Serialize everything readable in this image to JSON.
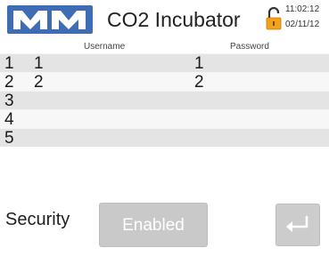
{
  "header": {
    "logo_text": "MM",
    "title": "CO2 Incubator",
    "time": "11:02:12",
    "date": "02/11/12"
  },
  "columns": {
    "username": "Username",
    "password": "Password"
  },
  "rows": [
    {
      "number": "1",
      "username": "1",
      "password": "1"
    },
    {
      "number": "2",
      "username": "2",
      "password": "2"
    },
    {
      "number": "3",
      "username": "",
      "password": ""
    },
    {
      "number": "4",
      "username": "",
      "password": ""
    },
    {
      "number": "5",
      "username": "",
      "password": ""
    }
  ],
  "security": {
    "label": "Security",
    "status_button": "Enabled"
  },
  "icons": {
    "lock": "unlocked-padlock-icon",
    "enter": "enter-return-icon"
  },
  "colors": {
    "logo_blue": "#3f6db5",
    "lock_orange": "#f2a31b",
    "row_shade": "#e4e4e4",
    "button_grey": "#c9c9c9"
  }
}
